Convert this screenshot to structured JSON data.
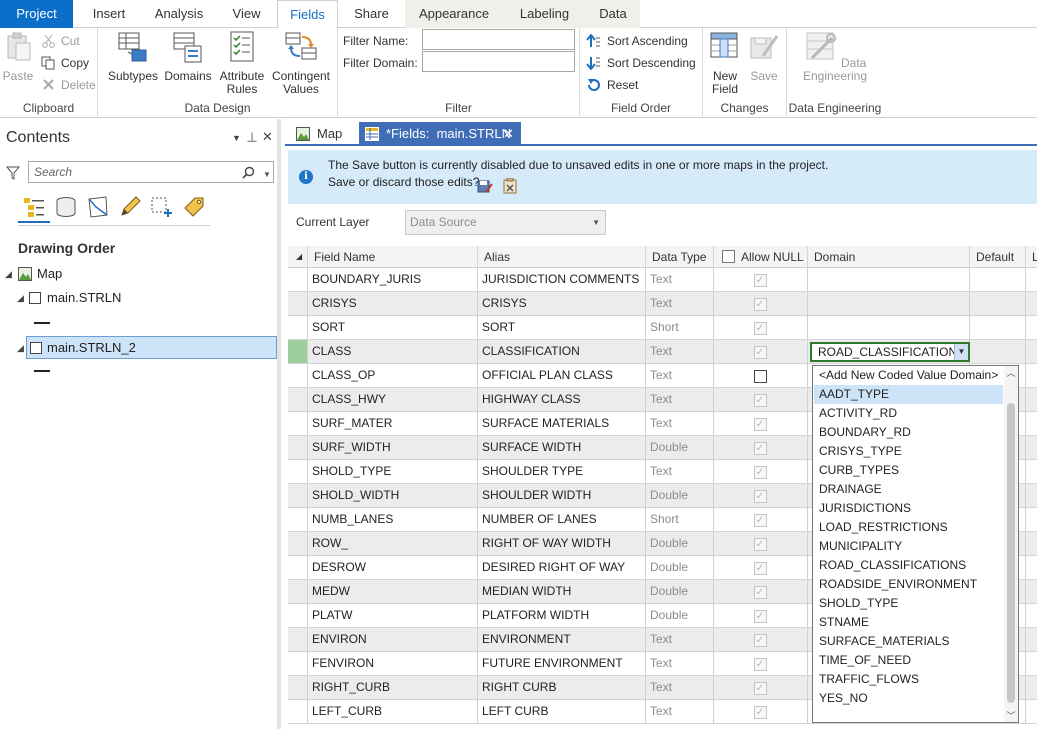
{
  "ribbon_tabs": [
    "Project",
    "Insert",
    "Analysis",
    "View",
    "Fields",
    "Share",
    "Appearance",
    "Labeling",
    "Data"
  ],
  "clipboard": {
    "paste": "Paste",
    "cut": "Cut",
    "copy": "Copy",
    "delete": "Delete",
    "label": "Clipboard"
  },
  "data_design": {
    "subtypes": "Subtypes",
    "domains": "Domains",
    "attribute_rules": "Attribute\nRules",
    "contingent_values": "Contingent\nValues",
    "label": "Data Design"
  },
  "filter": {
    "name_label": "Filter Name:",
    "domain_label": "Filter Domain:",
    "name_value": "",
    "domain_value": "",
    "label": "Filter"
  },
  "field_order": {
    "sort_asc": "Sort Ascending",
    "sort_desc": "Sort Descending",
    "reset": "Reset",
    "label": "Field Order"
  },
  "changes": {
    "new_field": "New\nField",
    "save": "Save",
    "label": "Changes"
  },
  "data_engineering": {
    "button": "Data\nEngineering",
    "label": "Data Engineering"
  },
  "contents": {
    "title": "Contents",
    "pin": "⊣",
    "search_placeholder": "Search",
    "drawing_order": "Drawing Order",
    "tree": {
      "map": "Map",
      "layer1": "main.STRLN",
      "layer2": "main.STRLN_2"
    }
  },
  "doc_tabs": {
    "map": "Map",
    "fields": "*Fields:  main.STRLN"
  },
  "infobar": {
    "line1": "The Save button is currently disabled due to unsaved edits in one or more maps in the project.",
    "line2": "Save or discard those edits?"
  },
  "current_layer": {
    "label": "Current Layer",
    "value": "Data Source"
  },
  "grid": {
    "headers": [
      "Field Name",
      "Alias",
      "Data Type",
      "Allow NULL",
      "Domain",
      "Default",
      "L"
    ],
    "rows": [
      {
        "name": "BOUNDARY_JURIS",
        "alias": "JURISDICTION COMMENTS",
        "type": "Text",
        "allow_null": true
      },
      {
        "name": "CRISYS",
        "alias": "CRISYS",
        "type": "Text",
        "allow_null": true
      },
      {
        "name": "SORT",
        "alias": "SORT",
        "type": "Short",
        "allow_null": true
      },
      {
        "name": "CLASS",
        "alias": "CLASSIFICATION",
        "type": "Text",
        "allow_null": true
      },
      {
        "name": "CLASS_OP",
        "alias": "OFFICIAL PLAN CLASS",
        "type": "Text",
        "allow_null": false
      },
      {
        "name": "CLASS_HWY",
        "alias": "HIGHWAY CLASS",
        "type": "Text",
        "allow_null": true
      },
      {
        "name": "SURF_MATER",
        "alias": "SURFACE MATERIALS",
        "type": "Text",
        "allow_null": true
      },
      {
        "name": "SURF_WIDTH",
        "alias": "SURFACE WIDTH",
        "type": "Double",
        "allow_null": true
      },
      {
        "name": "SHOLD_TYPE",
        "alias": "SHOULDER TYPE",
        "type": "Text",
        "allow_null": true
      },
      {
        "name": "SHOLD_WIDTH",
        "alias": "SHOULDER WIDTH",
        "type": "Double",
        "allow_null": true
      },
      {
        "name": "NUMB_LANES",
        "alias": "NUMBER OF LANES",
        "type": "Short",
        "allow_null": true
      },
      {
        "name": "ROW_",
        "alias": "RIGHT OF WAY WIDTH",
        "type": "Double",
        "allow_null": true
      },
      {
        "name": "DESROW",
        "alias": "DESIRED RIGHT OF WAY",
        "type": "Double",
        "allow_null": true
      },
      {
        "name": "MEDW",
        "alias": "MEDIAN WIDTH",
        "type": "Double",
        "allow_null": true
      },
      {
        "name": "PLATW",
        "alias": "PLATFORM WIDTH",
        "type": "Double",
        "allow_null": true
      },
      {
        "name": "ENVIRON",
        "alias": "ENVIRONMENT",
        "type": "Text",
        "allow_null": true
      },
      {
        "name": "FENVIRON",
        "alias": "FUTURE ENVIRONMENT",
        "type": "Text",
        "allow_null": true
      },
      {
        "name": "RIGHT_CURB",
        "alias": "RIGHT CURB",
        "type": "Text",
        "allow_null": true
      },
      {
        "name": "LEFT_CURB",
        "alias": "LEFT CURB",
        "type": "Text",
        "allow_null": true
      }
    ],
    "editing_domain": "ROAD_CLASSIFICATIONS"
  },
  "domain_dropdown": {
    "items": [
      "<Add New Coded Value Domain>",
      "AADT_TYPE",
      "ACTIVITY_RD",
      "BOUNDARY_RD",
      "CRISYS_TYPE",
      "CURB_TYPES",
      "DRAINAGE",
      "JURISDICTIONS",
      "LOAD_RESTRICTIONS",
      "MUNICIPALITY",
      "ROAD_CLASSIFICATIONS",
      "ROADSIDE_ENVIRONMENT",
      "SHOLD_TYPE",
      "STNAME",
      "SURFACE_MATERIALS",
      "TIME_OF_NEED",
      "TRAFFIC_FLOWS",
      "YES_NO"
    ],
    "highlighted_index": 1
  },
  "colors": {
    "accent": "#0a6ec8",
    "active_doc_tab": "#3f6eb7",
    "info_bg": "#d6ebf9",
    "edit_border": "#2c7a2c",
    "row_edit_marker": "#9ccf9c"
  }
}
